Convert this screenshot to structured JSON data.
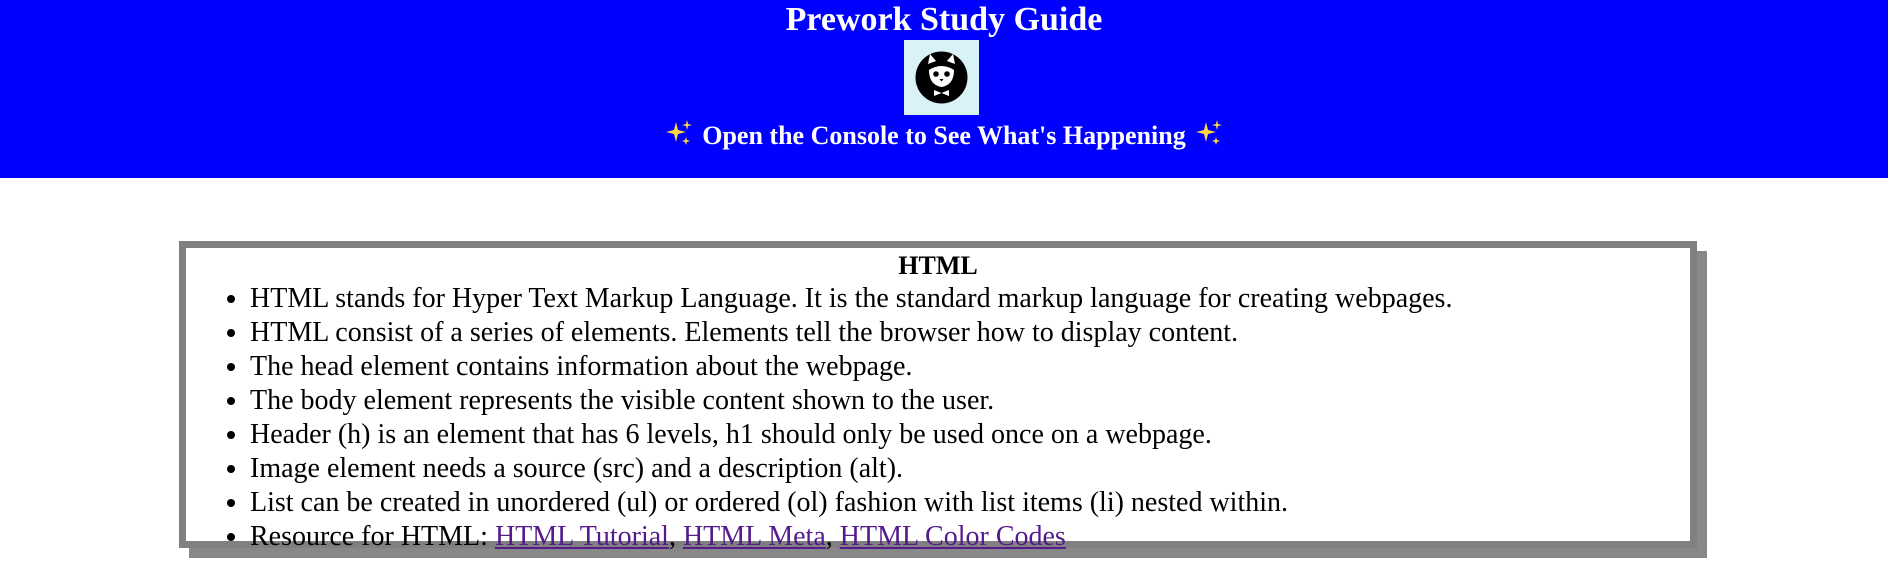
{
  "header": {
    "title": "Prework Study Guide",
    "logo_alt": "cat-avatar",
    "subtitle": "Open the Console to See What's Happening",
    "background_color": "#0000ff",
    "text_color": "#ffffff"
  },
  "card": {
    "title": "HTML",
    "items": [
      "HTML stands for Hyper Text Markup Language. It is the standard markup language for creating webpages.",
      "HTML consist of a series of elements. Elements tell the browser how to display content.",
      "The head element contains information about the webpage.",
      "The body element represents the visible content shown to the user.",
      "Header (h) is an element that has 6 levels, h1 should only be used once on a webpage.",
      "Image element needs a source (src) and a description (alt).",
      "List can be created in unordered (ul) or ordered (ol) fashion with list items (li) nested within."
    ],
    "resource_prefix": "Resource for HTML: ",
    "links": [
      "HTML Tutorial",
      "HTML Meta",
      "HTML Color Codes"
    ],
    "separator": ", ",
    "border_color": "#808080",
    "link_color": "#551a8b"
  }
}
